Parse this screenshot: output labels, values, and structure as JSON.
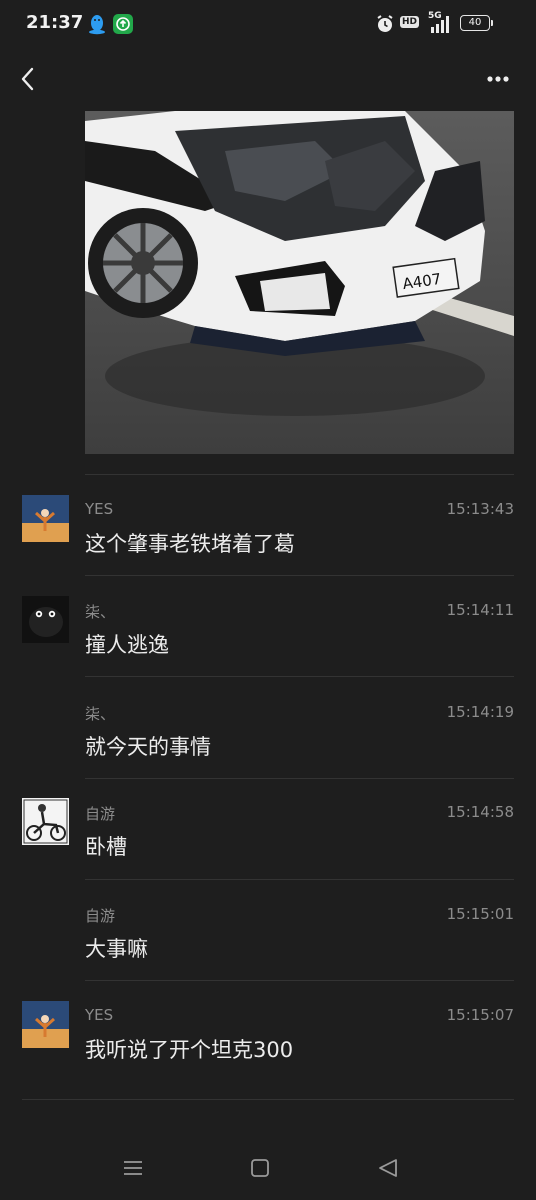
{
  "status_bar": {
    "time": "21:37",
    "hd": "HD",
    "network": "5G",
    "battery": "40",
    "icons": [
      "qq-penguin-icon",
      "update-icon",
      "alarm-icon",
      "signal-icon",
      "battery-icon"
    ]
  },
  "header": {
    "back_icon": "chevron-left-icon",
    "more_icon": "more-dots-icon"
  },
  "photo": {
    "plate_text": "A407"
  },
  "messages": [
    {
      "sender": "YES",
      "time": "15:13:43",
      "text": "这个肇事老铁堵着了葛",
      "avatar": "avatar-yes"
    },
    {
      "sender": "柒、",
      "time": "15:14:11",
      "text": "撞人逃逸",
      "avatar": "avatar-qi"
    },
    {
      "sender": "柒、",
      "time": "15:14:19",
      "text": "就今天的事情",
      "avatar": ""
    },
    {
      "sender": "自游",
      "time": "15:14:58",
      "text": "卧槽",
      "avatar": "avatar-ziyou"
    },
    {
      "sender": "自游",
      "time": "15:15:01",
      "text": "大事嘛",
      "avatar": ""
    },
    {
      "sender": "YES",
      "time": "15:15:07",
      "text": "我听说了开个坦克300",
      "avatar": "avatar-yes"
    }
  ],
  "nav_bar": {
    "icons": [
      "menu-icon",
      "home-square-icon",
      "back-triangle-icon"
    ]
  }
}
